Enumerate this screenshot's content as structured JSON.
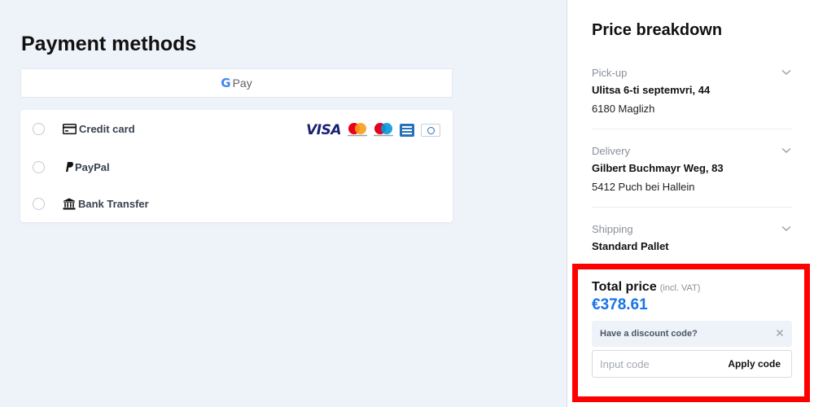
{
  "payment": {
    "title": "Payment methods",
    "gpay": {
      "g": "G",
      "label": "Pay"
    },
    "methods": [
      {
        "label": "Credit card",
        "icon": "credit-card-icon"
      },
      {
        "label": "PayPal",
        "icon": "paypal-icon"
      },
      {
        "label": "Bank Transfer",
        "icon": "bank-icon"
      }
    ],
    "brands": {
      "visa": "VISA"
    }
  },
  "breakdown": {
    "title": "Price breakdown",
    "pickup": {
      "label": "Pick-up",
      "line1": "Ulitsa 6-ti septemvri, 44",
      "line2": "6180 Maglizh"
    },
    "delivery": {
      "label": "Delivery",
      "line1": "Gilbert Buchmayr Weg, 83",
      "line2": "5412 Puch bei Hallein"
    },
    "shipping": {
      "label": "Shipping",
      "line1": "Standard Pallet"
    },
    "total": {
      "label": "Total price",
      "note": "(incl. VAT)",
      "price": "€378.61"
    },
    "discount": {
      "prompt": "Have a discount code?",
      "placeholder": "Input code",
      "apply_label": "Apply code"
    }
  },
  "colors": {
    "accent": "#1a73e8",
    "highlight": "#ff0000",
    "background": "#eef2f9"
  }
}
